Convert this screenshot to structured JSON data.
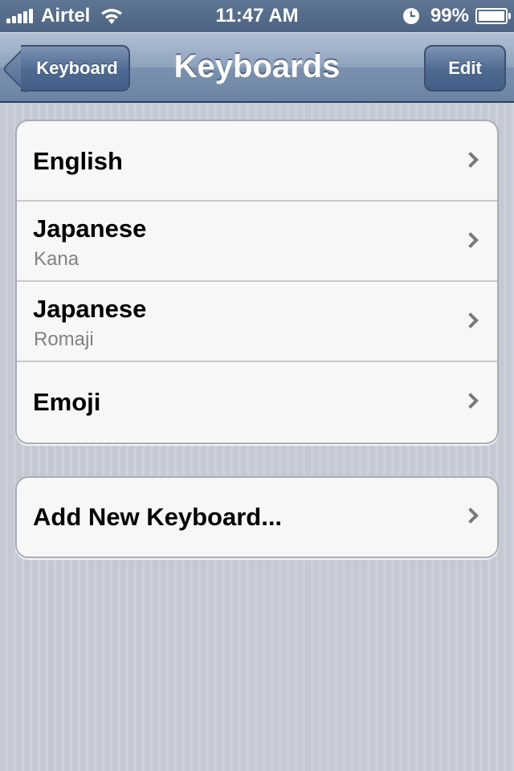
{
  "status_bar": {
    "carrier": "Airtel",
    "time": "11:47 AM",
    "battery_percent": "99%",
    "battery_level": 0.99
  },
  "nav": {
    "title": "Keyboards",
    "back_label": "Keyboard",
    "edit_label": "Edit"
  },
  "keyboards": [
    {
      "label": "English",
      "detail": ""
    },
    {
      "label": "Japanese",
      "detail": "Kana"
    },
    {
      "label": "Japanese",
      "detail": "Romaji"
    },
    {
      "label": "Emoji",
      "detail": ""
    }
  ],
  "add_keyboard": {
    "label": "Add New Keyboard..."
  }
}
